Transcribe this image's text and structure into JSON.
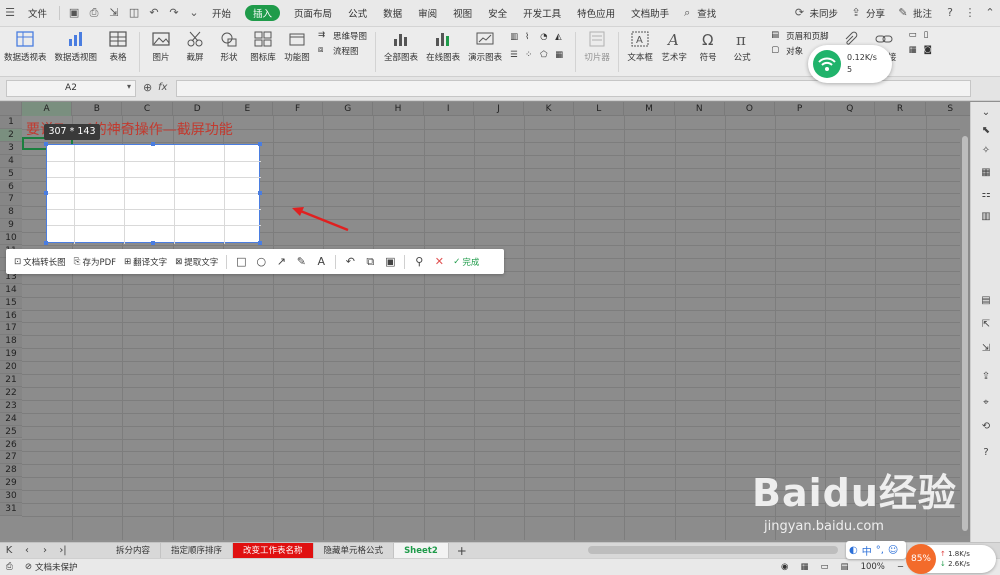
{
  "menubar": {
    "file": "文件",
    "tabs": [
      "开始",
      "插入",
      "页面布局",
      "公式",
      "数据",
      "审阅",
      "视图",
      "安全",
      "开发工具",
      "特色应用",
      "文档助手"
    ],
    "active_tab": "插入",
    "search": "查找",
    "sync": "未同步",
    "share": "分享",
    "comment": "批注"
  },
  "ribbon": {
    "pivot_table": "数据透视表",
    "pivot_chart": "数据透视图",
    "table": "表格",
    "picture": "图片",
    "screenshot": "截屏",
    "shape": "形状",
    "icon_lib": "图标库",
    "func_chart": "功能图",
    "mindmap": "思维导图",
    "flowchart": "流程图",
    "all_charts": "全部图表",
    "online_chart": "在线图表",
    "demo_chart": "演示图表",
    "slicer": "切片器",
    "textbox": "文本框",
    "art": "艺术字",
    "symbol": "符号",
    "formula": "公式",
    "header_footer": "页眉和页脚",
    "object": "对象",
    "attachment": "附件",
    "hyperlink": "超链接"
  },
  "formula_bar": {
    "name_box": "A2",
    "fx": "fx",
    "content": ""
  },
  "sheet": {
    "columns": [
      "A",
      "B",
      "C",
      "D",
      "E",
      "F",
      "G",
      "H",
      "I",
      "J",
      "K",
      "L",
      "M",
      "N",
      "O",
      "P",
      "Q",
      "R",
      "S"
    ],
    "rows": [
      "1",
      "2",
      "3",
      "4",
      "5",
      "6",
      "7",
      "8",
      "9",
      "10",
      "11",
      "12",
      "13",
      "14",
      "15",
      "16",
      "17",
      "18",
      "19",
      "20",
      "21",
      "22",
      "23",
      "24",
      "25",
      "26",
      "27",
      "28",
      "29",
      "30",
      "31"
    ],
    "a1_text": "要说Excel的神奇操作—截屏功能"
  },
  "capture": {
    "size_label": "307 * 143",
    "toolbar": {
      "long_image": "文档转长图",
      "save_pdf": "存为PDF",
      "translate": "翻译文字",
      "extract": "提取文字",
      "done": "完成"
    }
  },
  "tabs": {
    "sheets": [
      "拆分内容",
      "指定顺序排序",
      "改变工作表名称",
      "隐藏单元格公式",
      "Sheet2"
    ],
    "active": "Sheet2",
    "highlighted": "改变工作表名称"
  },
  "status": {
    "doc_state": "文档未保护",
    "zoom": "100%"
  },
  "network_widget": {
    "speed": "0.12K/s",
    "count": "5"
  },
  "speed_widget": {
    "percent": "85%",
    "up": "1.8K/s",
    "down": "2.6K/s"
  },
  "ime": {
    "mode": "中"
  },
  "watermark": {
    "brand": "Baidu经验",
    "url": "jingyan.baidu.com"
  },
  "colors": {
    "accent_green": "#1f9b4a",
    "title_red": "#c23a2f",
    "selection_blue": "#4a7de0",
    "tab_red": "#e01010"
  }
}
